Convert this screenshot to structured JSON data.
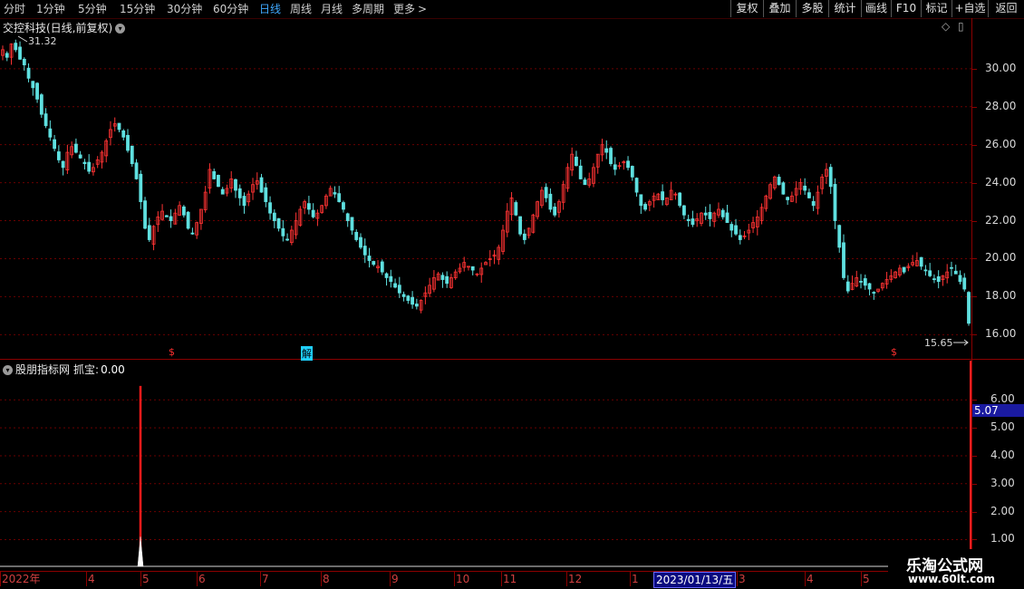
{
  "toolbar": {
    "periods": [
      "分时",
      "1分钟",
      "5分钟",
      "15分钟",
      "30分钟",
      "60分钟",
      "日线",
      "周线",
      "月线",
      "多周期",
      "更多"
    ],
    "active_period": "日线",
    "more_arrow": ">",
    "buttons": [
      "复权",
      "叠加",
      "多股",
      "统计",
      "画线",
      "F10",
      "标记",
      "+自选",
      "返回"
    ]
  },
  "main_chart": {
    "title": "交控科技(日线,前复权)",
    "high_label": "31.32",
    "low_label": "15.65",
    "markers": {
      "dollar": "$",
      "jie": "解"
    },
    "panel_controls": [
      "◇",
      "▯"
    ],
    "colors": {
      "up": "#ff3333",
      "down": "#5fe0e0",
      "grid": "#6a0000"
    },
    "y_axis": {
      "ticks": [
        "30.00",
        "28.00",
        "26.00",
        "24.00",
        "22.00",
        "20.00",
        "18.00",
        "16.00"
      ],
      "range": [
        15.3,
        31.9
      ]
    }
  },
  "indicator": {
    "title": "股朋指标网",
    "label": "抓宝:",
    "value": "0.00",
    "current_value": "5.07",
    "y_axis": {
      "ticks": [
        "6.00",
        "5.00",
        "4.00",
        "3.00",
        "2.00",
        "1.00"
      ],
      "range": [
        0.95,
        6.95
      ]
    },
    "spike": {
      "red_peak": 6.5,
      "white_peak": 1.1
    }
  },
  "date_axis": {
    "months": [
      "2022年",
      "4",
      "5",
      "6",
      "7",
      "8",
      "9",
      "10",
      "11",
      "12",
      "1",
      "3",
      "4",
      "5"
    ],
    "highlight": "2023/01/13/五"
  },
  "watermark": {
    "title": "乐淘公式网",
    "url": "www.60lt.com"
  },
  "chart_data": {
    "type": "candlestick",
    "series": [
      {
        "name": "交控科技",
        "values": [
          31.0,
          30.6,
          31.3,
          31.0,
          30.5,
          30.2,
          29.5,
          29.0,
          28.4,
          27.6,
          27.0,
          26.4,
          25.8,
          25.2,
          24.8,
          25.6,
          25.9,
          25.6,
          25.3,
          25.0,
          24.6,
          24.8,
          25.2,
          25.6,
          26.2,
          26.8,
          27.1,
          26.8,
          26.4,
          25.7,
          25.0,
          24.2,
          23.0,
          21.6,
          21.0,
          21.7,
          22.2,
          22.5,
          22.2,
          22.0,
          22.4,
          22.8,
          22.3,
          21.6,
          21.3,
          21.9,
          22.6,
          23.5,
          24.7,
          24.2,
          23.8,
          23.4,
          23.7,
          24.2,
          23.6,
          23.2,
          22.8,
          23.4,
          23.9,
          24.1,
          23.5,
          23.0,
          22.4,
          22.0,
          21.6,
          21.2,
          21.0,
          21.5,
          22.0,
          22.6,
          23.0,
          22.6,
          22.2,
          22.4,
          22.8,
          23.3,
          23.7,
          23.4,
          23.0,
          22.6,
          22.0,
          21.5,
          21.0,
          20.6,
          20.2,
          19.9,
          19.7,
          19.6,
          19.3,
          19.0,
          18.8,
          18.5,
          18.2,
          18.0,
          17.8,
          17.6,
          17.5,
          17.8,
          18.2,
          18.6,
          19.0,
          19.2,
          18.9,
          18.7,
          19.0,
          19.3,
          19.5,
          19.8,
          19.6,
          19.4,
          19.2,
          19.5,
          19.8,
          20.0,
          20.2,
          20.6,
          21.5,
          22.5,
          23.2,
          22.3,
          21.3,
          21.0,
          21.6,
          22.3,
          23.0,
          23.6,
          23.2,
          22.6,
          22.3,
          23.0,
          23.9,
          24.8,
          25.5,
          24.9,
          24.2,
          23.9,
          24.2,
          24.8,
          25.5,
          26.0,
          25.6,
          25.0,
          24.7,
          24.9,
          25.1,
          24.8,
          24.3,
          23.5,
          22.8,
          22.6,
          23.0,
          23.3,
          23.4,
          23.1,
          23.2,
          23.6,
          23.4,
          22.8,
          22.3,
          22.0,
          21.8,
          22.1,
          22.4,
          22.3,
          22.1,
          22.4,
          22.6,
          22.2,
          21.9,
          21.5,
          21.3,
          21.0,
          21.2,
          21.5,
          21.9,
          22.2,
          22.7,
          23.3,
          23.9,
          24.3,
          23.9,
          23.4,
          23.1,
          23.3,
          23.7,
          24.0,
          23.6,
          23.2,
          22.8,
          23.5,
          24.3,
          24.7,
          23.8,
          22.0,
          20.6,
          19.0,
          18.3,
          18.7,
          19.0,
          18.8,
          18.6,
          18.4,
          18.2,
          18.4,
          18.7,
          18.9,
          19.1,
          19.3,
          19.5,
          19.3,
          19.6,
          19.8,
          19.9,
          19.6,
          19.4,
          19.1,
          18.9,
          18.8,
          19.1,
          19.3,
          19.5,
          19.2,
          18.8,
          18.4,
          16.6
        ]
      }
    ]
  }
}
